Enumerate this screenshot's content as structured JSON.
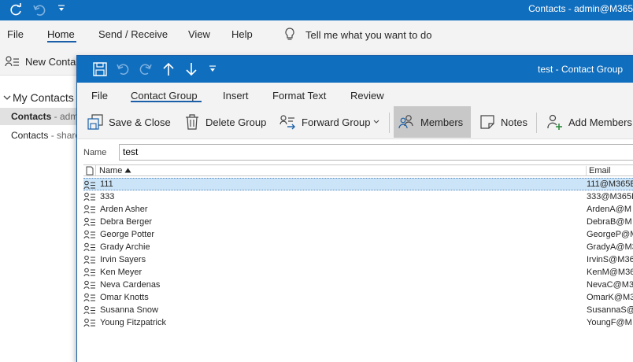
{
  "outlook": {
    "title": "Contacts - admin@M365",
    "tabs": [
      "File",
      "Home",
      "Send / Receive",
      "View",
      "Help"
    ],
    "active_tab": "Home",
    "tell_me": "Tell me what you want to do",
    "new_contact": "New Conta"
  },
  "nav": {
    "header": "My Contacts",
    "items": [
      {
        "label": "Contacts",
        "suffix": " - admi",
        "selected": true
      },
      {
        "label": "Contacts",
        "suffix": " - share",
        "selected": false
      }
    ]
  },
  "dialog": {
    "title": "test  -  Contact Group",
    "tabs": [
      "File",
      "Contact Group",
      "Insert",
      "Format Text",
      "Review"
    ],
    "active_tab": "Contact Group",
    "ribbon": {
      "save_close": "Save & Close",
      "delete_group": "Delete Group",
      "forward_group": "Forward Group",
      "members": "Members",
      "notes": "Notes",
      "add_members": "Add Members"
    },
    "name_label": "Name",
    "name_value": "test",
    "columns": {
      "name": "Name",
      "email": "Email"
    },
    "members": [
      {
        "name": "111",
        "email": "111@M365E",
        "selected": true
      },
      {
        "name": "333",
        "email": "333@M365E"
      },
      {
        "name": "Arden Asher",
        "email": "ArdenA@M"
      },
      {
        "name": "Debra Berger",
        "email": "DebraB@M"
      },
      {
        "name": "George Potter",
        "email": "GeorgeP@M"
      },
      {
        "name": "Grady Archie",
        "email": "GradyA@M3"
      },
      {
        "name": "Irvin Sayers",
        "email": "IrvinS@M36"
      },
      {
        "name": "Ken Meyer",
        "email": "KenM@M36"
      },
      {
        "name": "Neva Cardenas",
        "email": "NevaC@M3"
      },
      {
        "name": "Omar Knotts",
        "email": "OmarK@M3"
      },
      {
        "name": "Susanna Snow",
        "email": "SusannaS@"
      },
      {
        "name": "Young Fitzpatrick",
        "email": "YoungF@M"
      }
    ]
  },
  "colors": {
    "accent": "#106ebe",
    "selection": "#cce4f7",
    "ribbon_bg": "#f3f3f3"
  }
}
